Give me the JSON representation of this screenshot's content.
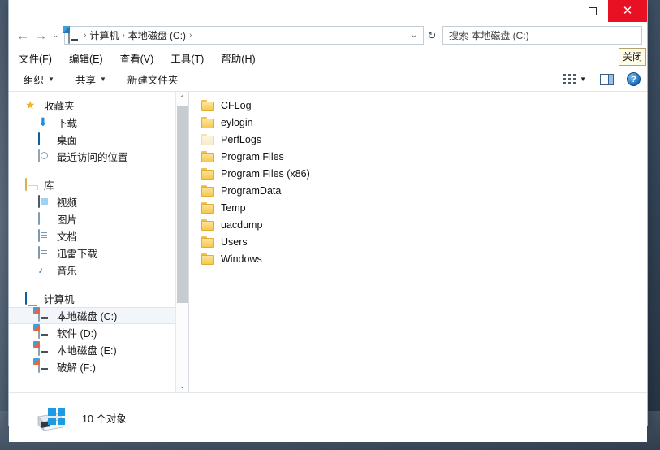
{
  "window": {
    "titlebar": {
      "minimize_label": "─",
      "maximize_label": "□",
      "close_label": "✕",
      "close_tooltip": "关闭"
    },
    "close_button_color": "#e81123"
  },
  "address_bar": {
    "back_label": "←",
    "forward_label": "→",
    "history_caret": "⌄",
    "breadcrumb_icon": "computer-icon",
    "crumbs": [
      "计算机",
      "本地磁盘 (C:)"
    ],
    "separator": "›",
    "dropdown_caret": "⌄",
    "refresh_label": "↻",
    "search_placeholder": "搜索 本地磁盘 (C:)",
    "search_value": ""
  },
  "menubar": {
    "items": [
      {
        "label": "文件(F)"
      },
      {
        "label": "编辑(E)"
      },
      {
        "label": "查看(V)"
      },
      {
        "label": "工具(T)"
      },
      {
        "label": "帮助(H)"
      }
    ]
  },
  "toolbar": {
    "items": [
      {
        "label": "组织",
        "caret": "▼"
      },
      {
        "label": "共享",
        "caret": "▼"
      },
      {
        "label": "新建文件夹",
        "caret": ""
      }
    ],
    "view_caret": "▼",
    "view_icon": "view-options-icon",
    "preview_icon": "preview-pane-icon",
    "help_icon": "help-icon",
    "help_label": "?"
  },
  "navigation_pane": {
    "groups": [
      {
        "header": {
          "label": "收藏夹",
          "icon": "star-icon"
        },
        "items": [
          {
            "label": "下载",
            "icon": "download-icon"
          },
          {
            "label": "桌面",
            "icon": "desktop-icon"
          },
          {
            "label": "最近访问的位置",
            "icon": "recent-places-icon"
          }
        ]
      },
      {
        "header": {
          "label": "库",
          "icon": "library-icon"
        },
        "items": [
          {
            "label": "视频",
            "icon": "video-icon"
          },
          {
            "label": "图片",
            "icon": "pictures-icon"
          },
          {
            "label": "文档",
            "icon": "documents-icon"
          },
          {
            "label": "迅雷下载",
            "icon": "thunder-download-icon"
          },
          {
            "label": "音乐",
            "icon": "music-icon"
          }
        ]
      },
      {
        "header": {
          "label": "计算机",
          "icon": "computer-icon"
        },
        "items": [
          {
            "label": "本地磁盘 (C:)",
            "icon": "system-drive-icon",
            "selected": true
          },
          {
            "label": "软件 (D:)",
            "icon": "drive-icon",
            "selected": false
          },
          {
            "label": "本地磁盘 (E:)",
            "icon": "drive-icon",
            "selected": false
          },
          {
            "label": "破解 (F:)",
            "icon": "drive-icon",
            "selected": false
          }
        ]
      }
    ],
    "scrollbar": {
      "up_arrow": "⌃",
      "down_arrow": "⌄"
    }
  },
  "file_list": {
    "items": [
      {
        "name": "CFLog",
        "icon": "folder-icon",
        "dim": false
      },
      {
        "name": "eylogin",
        "icon": "folder-icon",
        "dim": false
      },
      {
        "name": "PerfLogs",
        "icon": "folder-icon",
        "dim": true
      },
      {
        "name": "Program Files",
        "icon": "folder-icon",
        "dim": false
      },
      {
        "name": "Program Files (x86)",
        "icon": "folder-icon",
        "dim": false
      },
      {
        "name": "ProgramData",
        "icon": "folder-icon",
        "dim": false
      },
      {
        "name": "Temp",
        "icon": "folder-icon",
        "dim": false
      },
      {
        "name": "uacdump",
        "icon": "folder-icon",
        "dim": false
      },
      {
        "name": "Users",
        "icon": "folder-icon",
        "dim": false
      },
      {
        "name": "Windows",
        "icon": "folder-icon",
        "dim": false
      }
    ]
  },
  "status_bar": {
    "icon": "drive-icon",
    "text": "10 个对象"
  },
  "taskbar": {
    "start_icon": "windows-logo-icon"
  }
}
